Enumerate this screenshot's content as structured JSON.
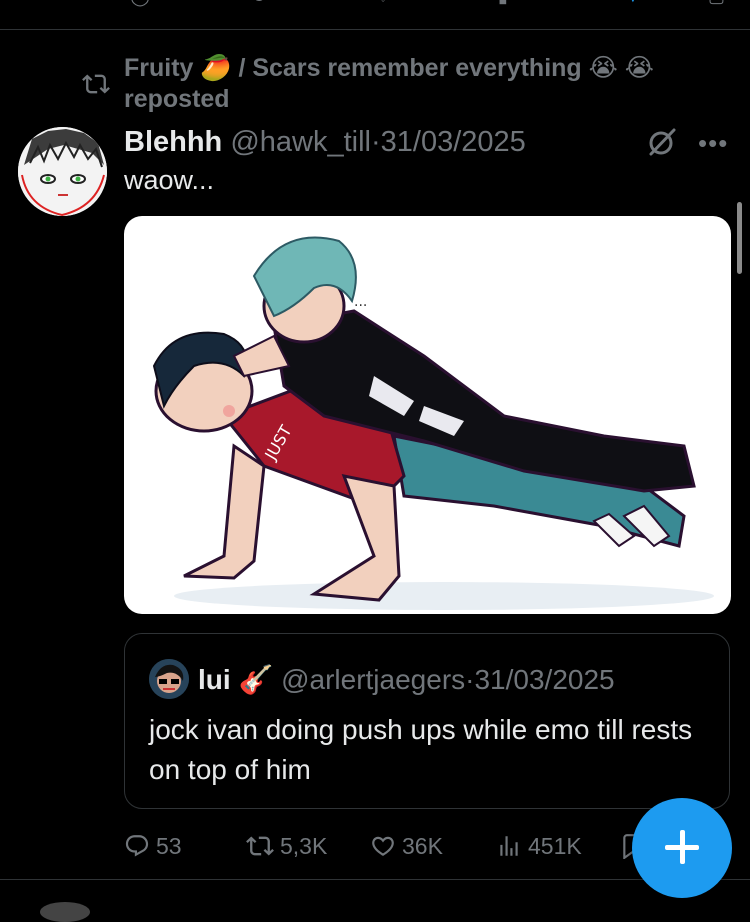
{
  "previous_tweet": {
    "actions": [
      "reply-icon",
      "repost-icon",
      "like-icon",
      "views-icon",
      "bookmark-icon",
      "share-icon"
    ]
  },
  "repost_banner": {
    "text": "Fruity 🥭 / Scars remember everything 😭 😭 reposted",
    "icon": "repost-icon"
  },
  "tweet": {
    "author_name": "Blehhh",
    "author_handle": "@hawk_till",
    "separator": "·",
    "date": "31/03/2025",
    "text": "waow...",
    "more_label": "•••",
    "media": {
      "kind": "illustration"
    },
    "quote": {
      "author_name": "lui 🎸",
      "author_handle": "@arlertjaegers",
      "separator": "·",
      "date": "31/03/2025",
      "text": "jock ivan doing push ups while emo till rests on top of him"
    },
    "stats": {
      "replies": "53",
      "reposts": "5,3K",
      "likes": "36K",
      "views": "451K"
    }
  },
  "fab": {
    "icon": "plus-icon",
    "accent": "#1d9bf0"
  },
  "colors": {
    "background": "#000000",
    "text": "#e7e9ea",
    "muted": "#71767b",
    "divider": "#2f3336"
  }
}
